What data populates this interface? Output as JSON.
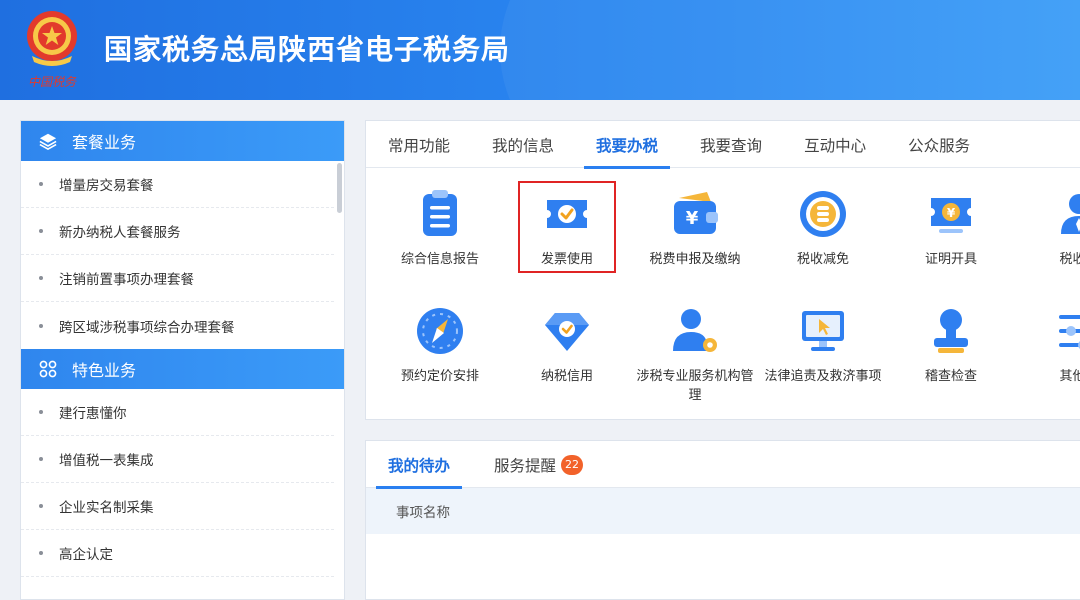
{
  "header": {
    "emblem_text": "中国税务",
    "title": "国家税务总局陕西省电子税务局"
  },
  "sidebar": {
    "sections": [
      {
        "title": "套餐业务",
        "icon": "layers-icon",
        "items": [
          "增量房交易套餐",
          "新办纳税人套餐服务",
          "注销前置事项办理套餐",
          "跨区域涉税事项综合办理套餐"
        ]
      },
      {
        "title": "特色业务",
        "icon": "apps-icon",
        "items": [
          "建行惠懂你",
          "增值税一表集成",
          "企业实名制采集",
          "高企认定"
        ]
      }
    ]
  },
  "functions": {
    "tabs": [
      "常用功能",
      "我的信息",
      "我要办税",
      "我要查询",
      "互动中心",
      "公众服务"
    ],
    "active_tab": "我要办税",
    "items": [
      {
        "label": "综合信息报告",
        "icon": "clipboard-list-icon"
      },
      {
        "label": "发票使用",
        "icon": "ticket-check-icon",
        "highlighted": true
      },
      {
        "label": "税费申报及缴纳",
        "icon": "wallet-yuan-icon"
      },
      {
        "label": "税收减免",
        "icon": "coin-stack-icon"
      },
      {
        "label": "证明开具",
        "icon": "yuan-certificate-icon"
      },
      {
        "label": "税收行",
        "icon": "person-icon"
      },
      {
        "label": "预约定价安排",
        "icon": "compass-icon"
      },
      {
        "label": "纳税信用",
        "icon": "diamond-check-icon"
      },
      {
        "label": "涉税专业服务机构管理",
        "icon": "user-gear-icon"
      },
      {
        "label": "法律追责及救济事项",
        "icon": "monitor-cursor-icon"
      },
      {
        "label": "稽查检查",
        "icon": "stamp-icon"
      },
      {
        "label": "其他服",
        "icon": "sliders-icon"
      }
    ],
    "colors": {
      "icon_blue": "#2f7ff0",
      "icon_light": "#9cc4fb",
      "highlight": "#e02424"
    }
  },
  "todo": {
    "tabs": [
      {
        "label": "我的待办",
        "active": true
      },
      {
        "label": "服务提醒",
        "badge": "22"
      }
    ],
    "columns": [
      "事项名称"
    ]
  }
}
